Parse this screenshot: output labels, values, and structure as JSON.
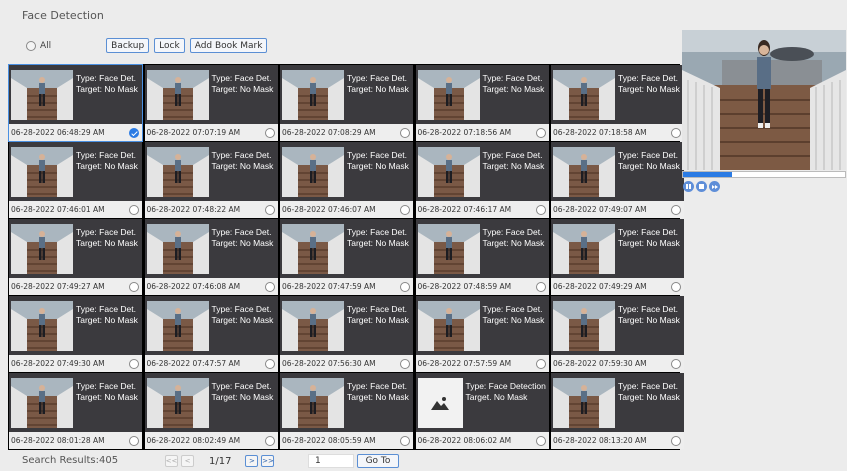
{
  "page": {
    "title": "Face Detection"
  },
  "toolbar": {
    "all_label": "All",
    "backup_label": "Backup",
    "lock_label": "Lock",
    "bookmark_label": "Add Book Mark"
  },
  "events": [
    {
      "type": "Type: Face Det.",
      "target": "Target: No Mask",
      "time": "06-28-2022 06:48:29 AM",
      "checked": true
    },
    {
      "type": "Type: Face Det.",
      "target": "Target: No Mask",
      "time": "06-28-2022 07:07:19 AM",
      "checked": false
    },
    {
      "type": "Type: Face Det.",
      "target": "Target: No Mask",
      "time": "06-28-2022 07:08:29 AM",
      "checked": false
    },
    {
      "type": "Type: Face Det.",
      "target": "Target: No Mask",
      "time": "06-28-2022 07:18:56 AM",
      "checked": false
    },
    {
      "type": "Type: Face Det.",
      "target": "Target: No Mask",
      "time": "06-28-2022 07:18:58 AM",
      "checked": false
    },
    {
      "type": "Type: Face Det.",
      "target": "Target: No Mask",
      "time": "06-28-2022 07:46:01 AM",
      "checked": false
    },
    {
      "type": "Type: Face Det.",
      "target": "Target: No Mask",
      "time": "06-28-2022 07:48:22 AM",
      "checked": false
    },
    {
      "type": "Type: Face Det.",
      "target": "Target: No Mask",
      "time": "06-28-2022 07:46:07 AM",
      "checked": false
    },
    {
      "type": "Type: Face Det.",
      "target": "Target: No Mask",
      "time": "06-28-2022 07:46:17 AM",
      "checked": false
    },
    {
      "type": "Type: Face Det.",
      "target": "Target: No Mask",
      "time": "06-28-2022 07:49:07 AM",
      "checked": false
    },
    {
      "type": "Type: Face Det.",
      "target": "Target: No Mask",
      "time": "06-28-2022 07:49:27 AM",
      "checked": false
    },
    {
      "type": "Type: Face Det.",
      "target": "Target: No Mask",
      "time": "06-28-2022 07:46:08 AM",
      "checked": false
    },
    {
      "type": "Type: Face Det.",
      "target": "Target: No Mask",
      "time": "06-28-2022 07:47:59 AM",
      "checked": false
    },
    {
      "type": "Type: Face Det.",
      "target": "Target: No Mask",
      "time": "06-28-2022 07:48:59 AM",
      "checked": false
    },
    {
      "type": "Type: Face Det.",
      "target": "Target: No Mask",
      "time": "06-28-2022 07:49:29 AM",
      "checked": false
    },
    {
      "type": "Type: Face Det.",
      "target": "Target: No Mask",
      "time": "06-28-2022 07:49:30 AM",
      "checked": false
    },
    {
      "type": "Type: Face Det.",
      "target": "Target: No Mask",
      "time": "06-28-2022 07:47:57 AM",
      "checked": false
    },
    {
      "type": "Type: Face Det.",
      "target": "Target: No Mask",
      "time": "06-28-2022 07:56:30 AM",
      "checked": false
    },
    {
      "type": "Type: Face Det.",
      "target": "Target: No Mask",
      "time": "06-28-2022 07:57:59 AM",
      "checked": false
    },
    {
      "type": "Type: Face Det.",
      "target": "Target: No Mask",
      "time": "06-28-2022 07:59:30 AM",
      "checked": false
    },
    {
      "type": "Type: Face Det.",
      "target": "Target: No Mask",
      "time": "06-28-2022 08:01:28 AM",
      "checked": false
    },
    {
      "type": "Type: Face Det.",
      "target": "Target: No Mask",
      "time": "06-28-2022 08:02:49 AM",
      "checked": false
    },
    {
      "type": "Type: Face Det.",
      "target": "Target: No Mask",
      "time": "06-28-2022 08:05:59 AM",
      "checked": false
    },
    {
      "type": "Type: Face Detection",
      "target": "Target.  No Mask",
      "time": "06-28-2022 08:06:02 AM",
      "checked": false,
      "placeholder": true
    },
    {
      "type": "Type: Face Det.",
      "target": "Target: No Mask",
      "time": "06-28-2022 08:13:20 AM",
      "checked": false
    }
  ],
  "preview": {
    "progress": 0.3
  },
  "footer": {
    "results_label": "Search Results:405",
    "page_info": "1/17",
    "goto_value": "1",
    "goto_label": "Go To",
    "first_icon": "double-left-icon",
    "prev_icon": "left-icon",
    "next_icon": "right-icon",
    "last_icon": "double-right-icon"
  },
  "colors": {
    "accent": "#2b7be4",
    "cell_bg": "#3b3a3e",
    "grid_border": "#000000"
  }
}
